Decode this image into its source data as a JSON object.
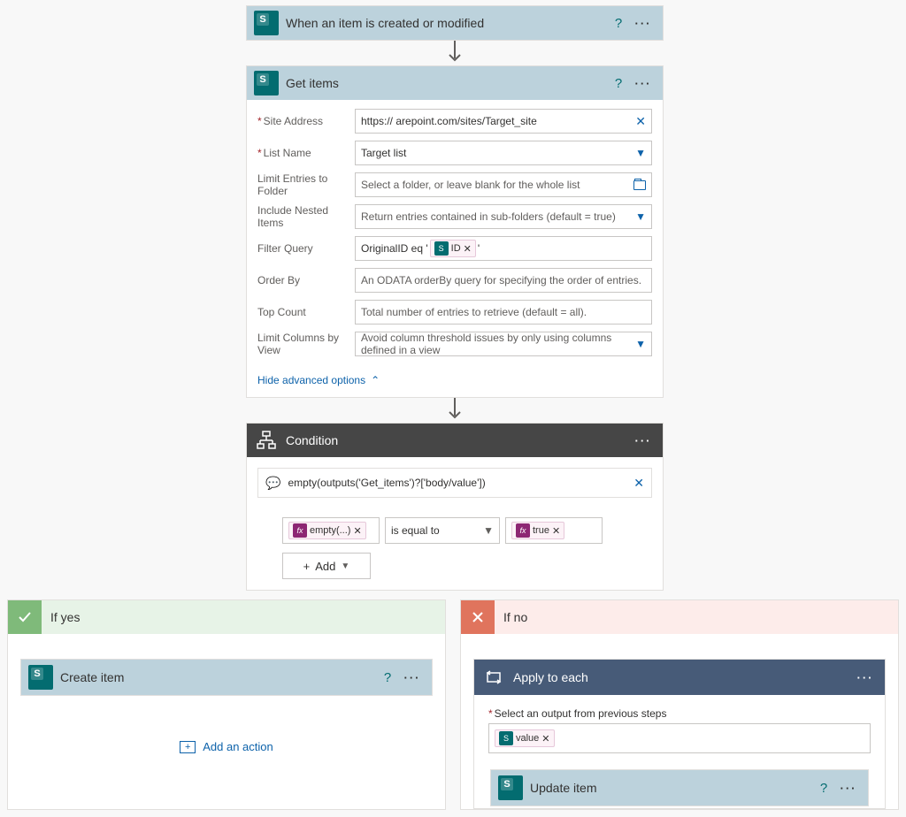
{
  "trigger": {
    "title": "When an item is created or modified"
  },
  "getItems": {
    "title": "Get items",
    "fields": {
      "siteAddress": {
        "label": "Site Address",
        "value": "https://             arepoint.com/sites/Target_site"
      },
      "listName": {
        "label": "List Name",
        "value": "Target list"
      },
      "limitFolder": {
        "label": "Limit Entries to Folder",
        "placeholder": "Select a folder, or leave blank for the whole list"
      },
      "nested": {
        "label": "Include Nested Items",
        "placeholder": "Return entries contained in sub-folders (default = true)"
      },
      "filter": {
        "label": "Filter Query",
        "prefix": "OriginalID eq '",
        "token": "ID",
        "suffix": "'"
      },
      "orderBy": {
        "label": "Order By",
        "placeholder": "An ODATA orderBy query for specifying the order of entries."
      },
      "topCount": {
        "label": "Top Count",
        "placeholder": "Total number of entries to retrieve (default = all)."
      },
      "limitCols": {
        "label": "Limit Columns by View",
        "placeholder": "Avoid column threshold issues by only using columns defined in a view"
      }
    },
    "hideAdvanced": "Hide advanced options"
  },
  "condition": {
    "title": "Condition",
    "expression": "empty(outputs('Get_items')?['body/value'])",
    "left": "empty(...)",
    "op": "is equal to",
    "right": "true",
    "add": "Add"
  },
  "yes": {
    "label": "If yes",
    "createItem": "Create item",
    "addAction": "Add an action"
  },
  "no": {
    "label": "If no",
    "apply": {
      "title": "Apply to each",
      "selectLabel": "Select an output from previous steps",
      "token": "value"
    },
    "updateItem": "Update item"
  }
}
